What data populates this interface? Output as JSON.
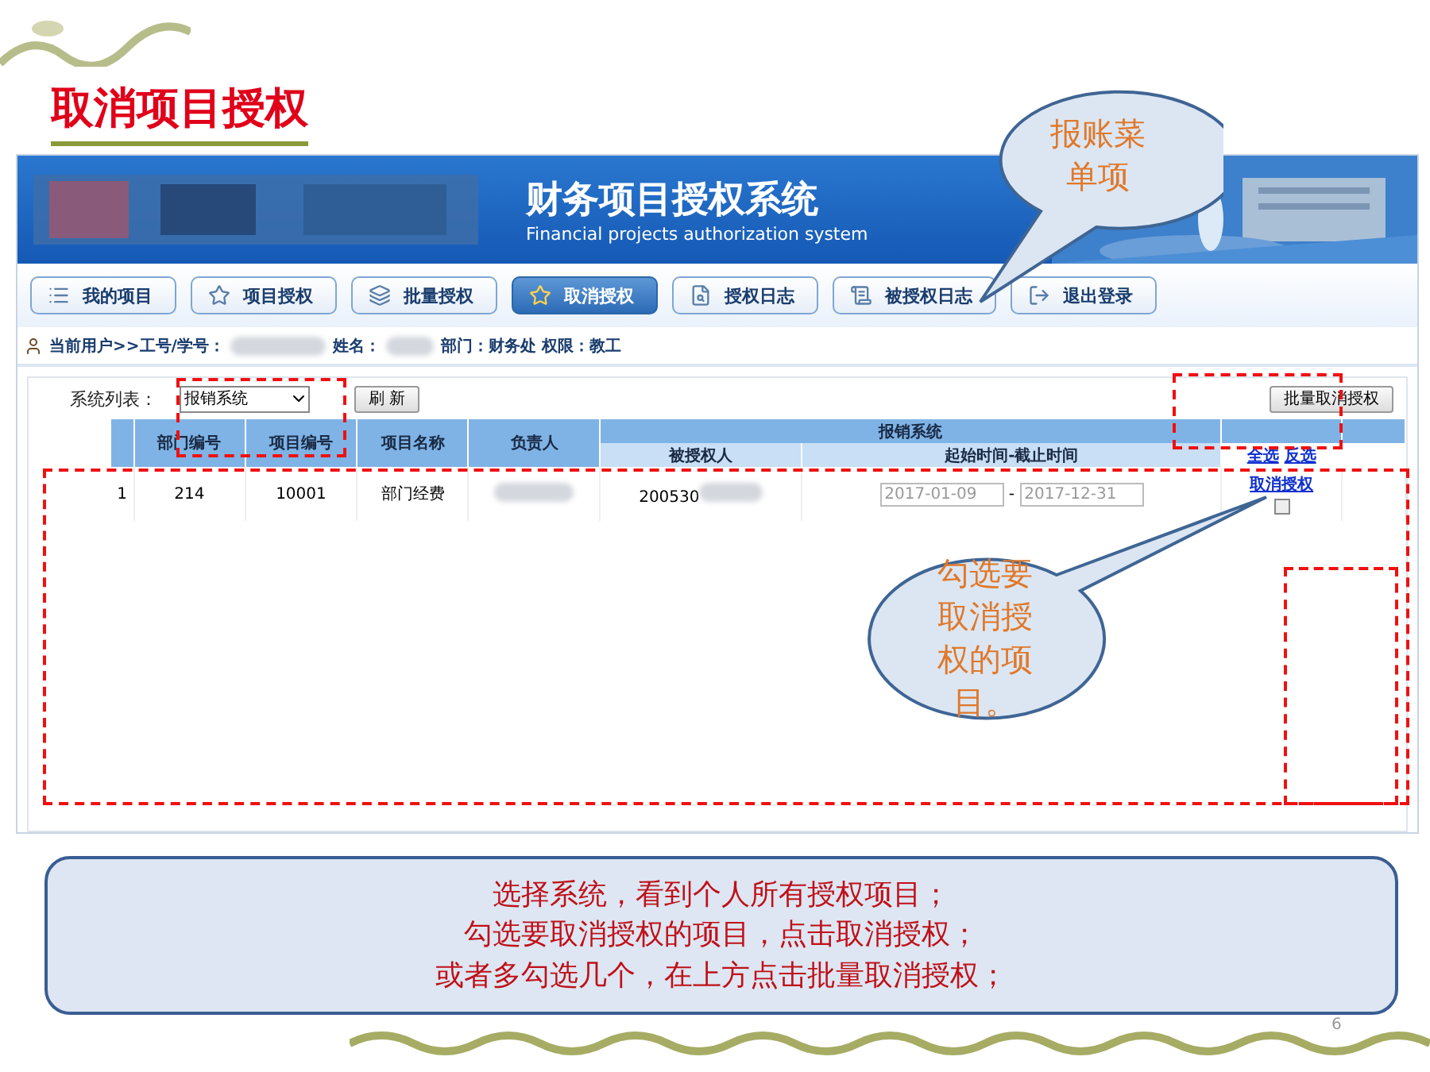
{
  "slide": {
    "title": "取消项目授权",
    "page_number": "6"
  },
  "app": {
    "title": "财务项目授权系统",
    "subtitle": "Financial projects authorization system",
    "nav": [
      {
        "label": "我的项目",
        "selected": false
      },
      {
        "label": "项目授权",
        "selected": false
      },
      {
        "label": "批量授权",
        "selected": false
      },
      {
        "label": "取消授权",
        "selected": true
      },
      {
        "label": "授权日志",
        "selected": false
      },
      {
        "label": "被授权日志",
        "selected": false
      },
      {
        "label": "退出登录",
        "selected": false
      }
    ],
    "user_bar": {
      "prefix": "当前用户>>工号/学号：",
      "name_label": "姓名：",
      "dept": "部门：财务处 权限：教工"
    },
    "system_label": "系统列表：",
    "system_select": "报销系统",
    "refresh": "刷 新",
    "batch_cancel": "批量取消授权",
    "table": {
      "columns": [
        "部门编号",
        "项目编号",
        "项目名称",
        "负责人"
      ],
      "group": "报销系统",
      "sub_columns": [
        "被授权人",
        "起始时间-截止时间"
      ],
      "select_all": "全选",
      "invert": "反选",
      "rows": [
        {
          "index": "1",
          "dept": "214",
          "project": "10001",
          "name": "部门经费",
          "grantee": "200530",
          "start": "2017-01-09",
          "sep": "-",
          "end": "2017-12-31",
          "action": "取消授权",
          "checked": false
        }
      ]
    }
  },
  "callouts": [
    {
      "text": "报账菜单项"
    },
    {
      "text": "勾选要取消授权的项目。"
    }
  ],
  "note": {
    "lines": [
      "选择系统，看到个人所有授权项目；",
      "勾选要取消授权的项目，点击取消授权；",
      "或者多勾选几个，在上方点击批量取消授权；"
    ]
  }
}
